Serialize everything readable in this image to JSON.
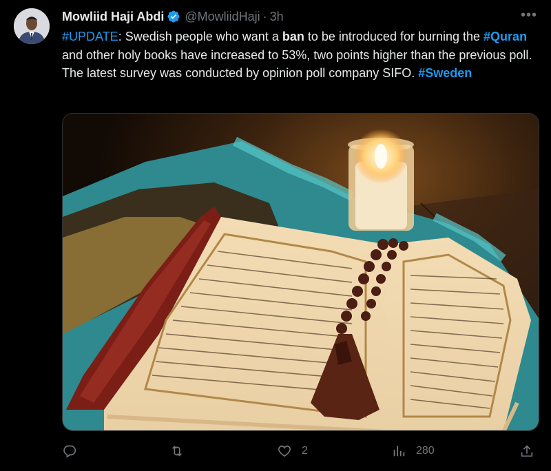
{
  "tweet": {
    "author_name": "Mowliid Haji Abdi",
    "handle": "@MowliidHaji",
    "separator": "·",
    "time": "3h",
    "more_label": "•••",
    "text": {
      "hashtag_update": "#UPDATE",
      "p1": ": Swedish people who want a ",
      "ban": "ban",
      "p2": " to be introduced for burning the ",
      "hashtag_quran": "#Quran",
      "p3": " and other holy books have increased to 53%, two points higher than the previous poll.",
      "p4": "The latest survey was conducted by opinion poll company SIFO. ",
      "hashtag_sweden": "#Sweden"
    }
  },
  "actions": {
    "reply_icon": "reply-icon",
    "retweet_icon": "retweet-icon",
    "like_icon": "heart-icon",
    "like_count": "2",
    "views_icon": "views-icon",
    "views_count": "280",
    "share_icon": "share-icon"
  },
  "colors": {
    "background": "#000000",
    "text": "#e7e9ea",
    "muted": "#71767b",
    "link": "#1d9bf0"
  }
}
